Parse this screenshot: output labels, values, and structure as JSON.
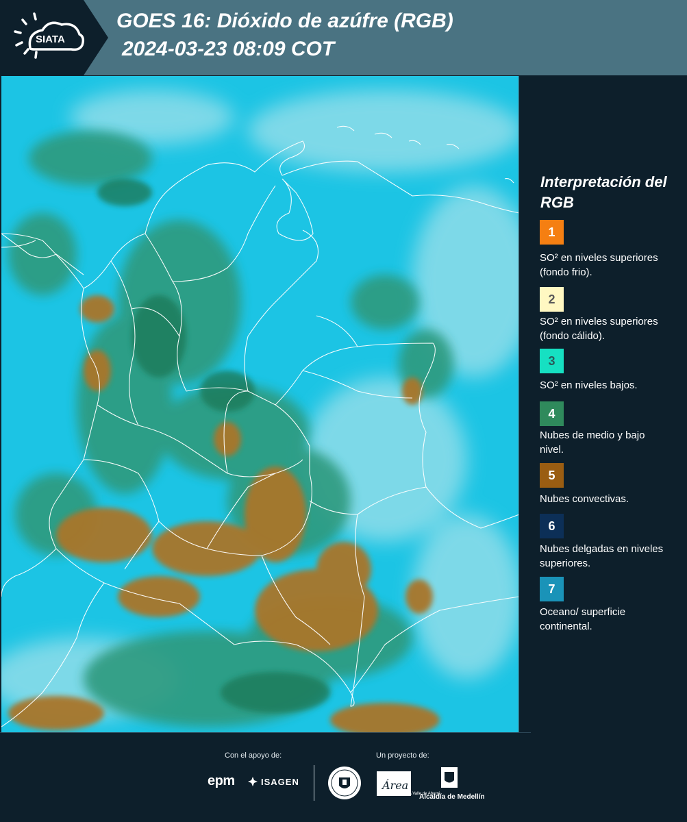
{
  "header": {
    "logo_text": "SIATA",
    "title_line1": "GOES 16: Dióxido de azúfre (RGB)",
    "title_line2": "2024-03-23 08:09 COT",
    "band_color": "#4a7382"
  },
  "map": {
    "description_icon": "satellite-rgb-map",
    "colors": {
      "ocean": "#1cc4e4",
      "cloud_high": "#8fdde9",
      "low_cloud": "#2e9a7e",
      "convective": "#a9762a",
      "border": "#ffffff"
    }
  },
  "legend": {
    "title": "Interpretación del RGB",
    "items": [
      {
        "number": "1",
        "color": "#f57f12",
        "number_color": "#ffffff",
        "label": "SO² en niveles superiores (fondo frio)."
      },
      {
        "number": "2",
        "color": "#fff8c2",
        "number_color": "#5a5a5a",
        "label": "SO² en niveles superiores (fondo cálido)."
      },
      {
        "number": "3",
        "color": "#16e0c2",
        "number_color": "#2a5a5a",
        "label": "SO² en niveles bajos."
      },
      {
        "number": "4",
        "color": "#2f8a5c",
        "number_color": "#ffffff",
        "label": "Nubes de medio y bajo nivel."
      },
      {
        "number": "5",
        "color": "#9a5d12",
        "number_color": "#ffffff",
        "label": "Nubes convectivas."
      },
      {
        "number": "6",
        "color": "#0c2f57",
        "number_color": "#ffffff",
        "label": "Nubes delgadas en niveles superiores."
      },
      {
        "number": "7",
        "color": "#1a93b8",
        "number_color": "#ffffff",
        "label": "Oceano/ superficie continental."
      }
    ]
  },
  "footer": {
    "support_label": "Con el apoyo de:",
    "project_label": "Un proyecto de:",
    "sponsor_epm": "epm",
    "sponsor_isagen": "ISAGEN",
    "area_label": "Área",
    "area_sub": "METROPOLITANA Valle de Aburrá",
    "alcaldia_label": "Alcaldía de Medellín"
  }
}
